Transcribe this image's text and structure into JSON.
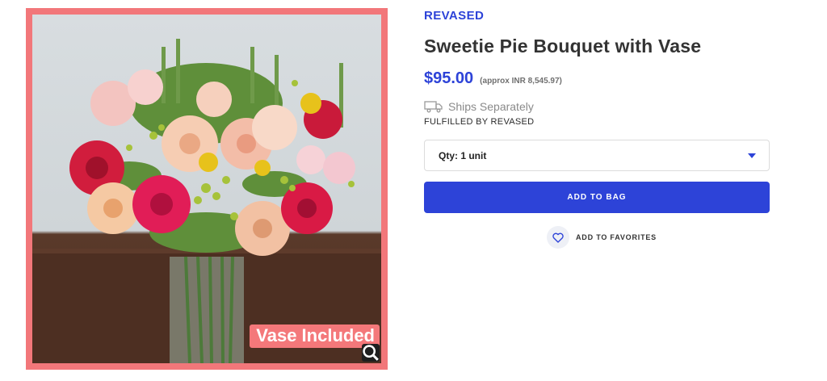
{
  "product": {
    "brand": "REVASED",
    "title": "Sweetie Pie Bouquet with Vase",
    "price": "$95.00",
    "approx_price": "(approx INR 8,545.97)",
    "shipping": "Ships Separately",
    "fulfilled_by": "FULFILLED BY REVASED"
  },
  "image": {
    "badge": "Vase Included",
    "frame_color": "#f2777a"
  },
  "quantity": {
    "selected": "Qty: 1 unit"
  },
  "actions": {
    "add_to_bag": "ADD TO BAG",
    "add_to_favorites": "ADD TO FAVORITES"
  },
  "colors": {
    "accent": "#2d43d8",
    "badge": "#f4787a"
  },
  "icons": [
    "truck-icon",
    "heart-icon",
    "zoom-icon",
    "chevron-down-icon"
  ]
}
